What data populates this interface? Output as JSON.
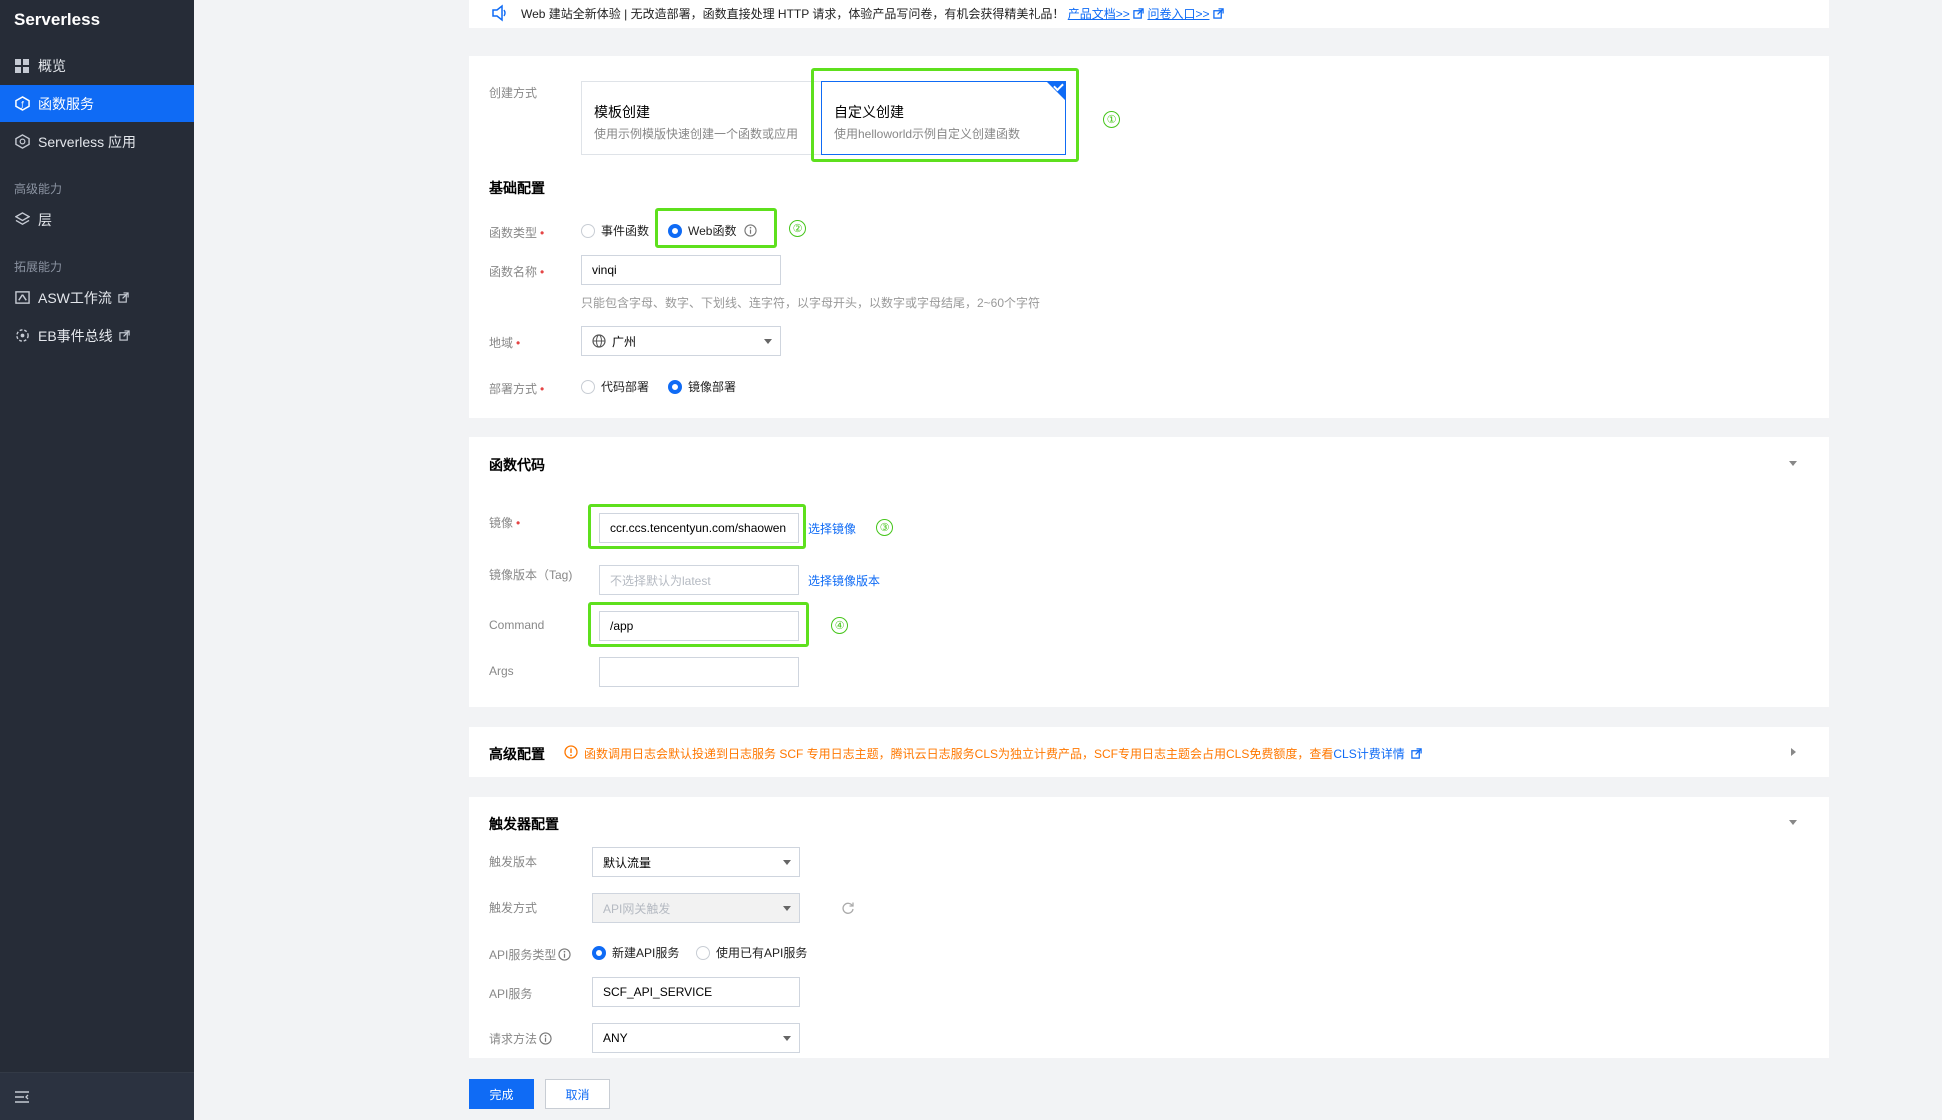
{
  "sidebar": {
    "brand": "Serverless",
    "items": [
      {
        "label": "概览",
        "icon": "grid-icon"
      },
      {
        "label": "函数服务",
        "icon": "function-icon"
      },
      {
        "label": "Serverless 应用",
        "icon": "app-icon"
      }
    ],
    "group_advanced": "高级能力",
    "layer": {
      "label": "层",
      "icon": "layers-icon"
    },
    "group_extend": "拓展能力",
    "asw": {
      "label": "ASW工作流",
      "icon": "workflow-icon"
    },
    "eb": {
      "label": "EB事件总线",
      "icon": "eventbus-icon"
    }
  },
  "notice": {
    "text": "Web 建站全新体验 | 无改造部署，函数直接处理 HTTP 请求，体验产品写问卷，有机会获得精美礼品！",
    "link_docs": "产品文档>>",
    "link_survey": "问卷入口>>"
  },
  "create": {
    "label": "创建方式",
    "template": {
      "title": "模板创建",
      "desc": "使用示例模版快速创建一个函数或应用"
    },
    "custom": {
      "title": "自定义创建",
      "desc": "使用helloworld示例自定义创建函数"
    }
  },
  "basic": {
    "title": "基础配置",
    "type_label": "函数类型",
    "type_event": "事件函数",
    "type_web": "Web函数",
    "name_label": "函数名称",
    "name_value": "vinqi",
    "name_hint": "只能包含字母、数字、下划线、连字符，以字母开头，以数字或字母结尾，2~60个字符",
    "region_label": "地域",
    "region_value": "广州",
    "deploy_label": "部署方式",
    "deploy_code": "代码部署",
    "deploy_image": "镜像部署"
  },
  "code": {
    "title": "函数代码",
    "image_label": "镜像",
    "image_value": "ccr.ccs.tencentyun.com/shaowen",
    "image_select": "选择镜像",
    "tag_label": "镜像版本（Tag)",
    "tag_placeholder": "不选择默认为latest",
    "tag_select": "选择镜像版本",
    "command_label": "Command",
    "command_value": "/app",
    "args_label": "Args",
    "args_value": ""
  },
  "advanced": {
    "title": "高级配置",
    "warning": "函数调用日志会默认投递到日志服务 SCF 专用日志主题，腾讯云日志服务CLS为独立计费产品，SCF专用日志主题会占用CLS免费额度，查看",
    "warning_link": "CLS计费详情"
  },
  "trigger": {
    "title": "触发器配置",
    "version_label": "触发版本",
    "version_value": "默认流量",
    "method_label": "触发方式",
    "method_value": "API网关触发",
    "api_type_label": "API服务类型",
    "api_type_new": "新建API服务",
    "api_type_existing": "使用已有API服务",
    "api_service_label": "API服务",
    "api_service_value": "SCF_API_SERVICE",
    "req_method_label": "请求方法",
    "req_method_value": "ANY"
  },
  "annotations": [
    "①",
    "②",
    "③",
    "④"
  ],
  "footer": {
    "done": "完成",
    "cancel": "取消"
  },
  "colors": {
    "accent": "#0f6bf5",
    "sidebar_bg": "#262c37",
    "highlight": "#5ee01d",
    "warning": "#ff7800"
  }
}
